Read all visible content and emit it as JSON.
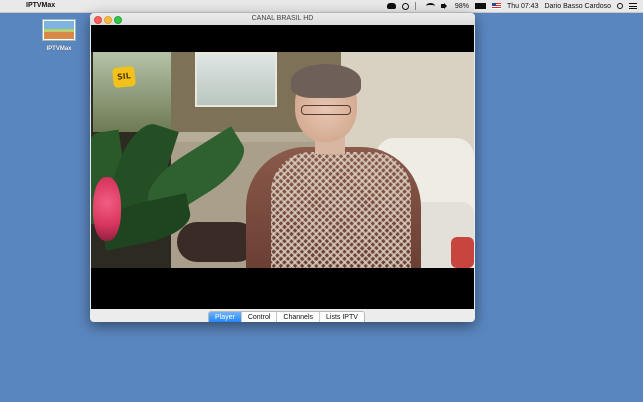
{
  "menubar": {
    "app_name": "IPTVMax",
    "battery_percent": "98%",
    "battery_level": 0.98,
    "clock": "Thu 07:43",
    "user": "Dario Basso Cardoso"
  },
  "desktop": {
    "icon_label": "IPTVMax"
  },
  "window": {
    "title": "CANAL BRASIL HD",
    "channel_logo": "SIL"
  },
  "tabs": [
    {
      "label": "Player",
      "active": true
    },
    {
      "label": "Control",
      "active": false
    },
    {
      "label": "Channels",
      "active": false
    },
    {
      "label": "Lists IPTV",
      "active": false
    }
  ],
  "colors": {
    "desktop": "#5a86bf",
    "active_tab": "#1a82fb",
    "close": "#fc605c",
    "minimize": "#fdbc40",
    "maximize": "#34c84a"
  }
}
